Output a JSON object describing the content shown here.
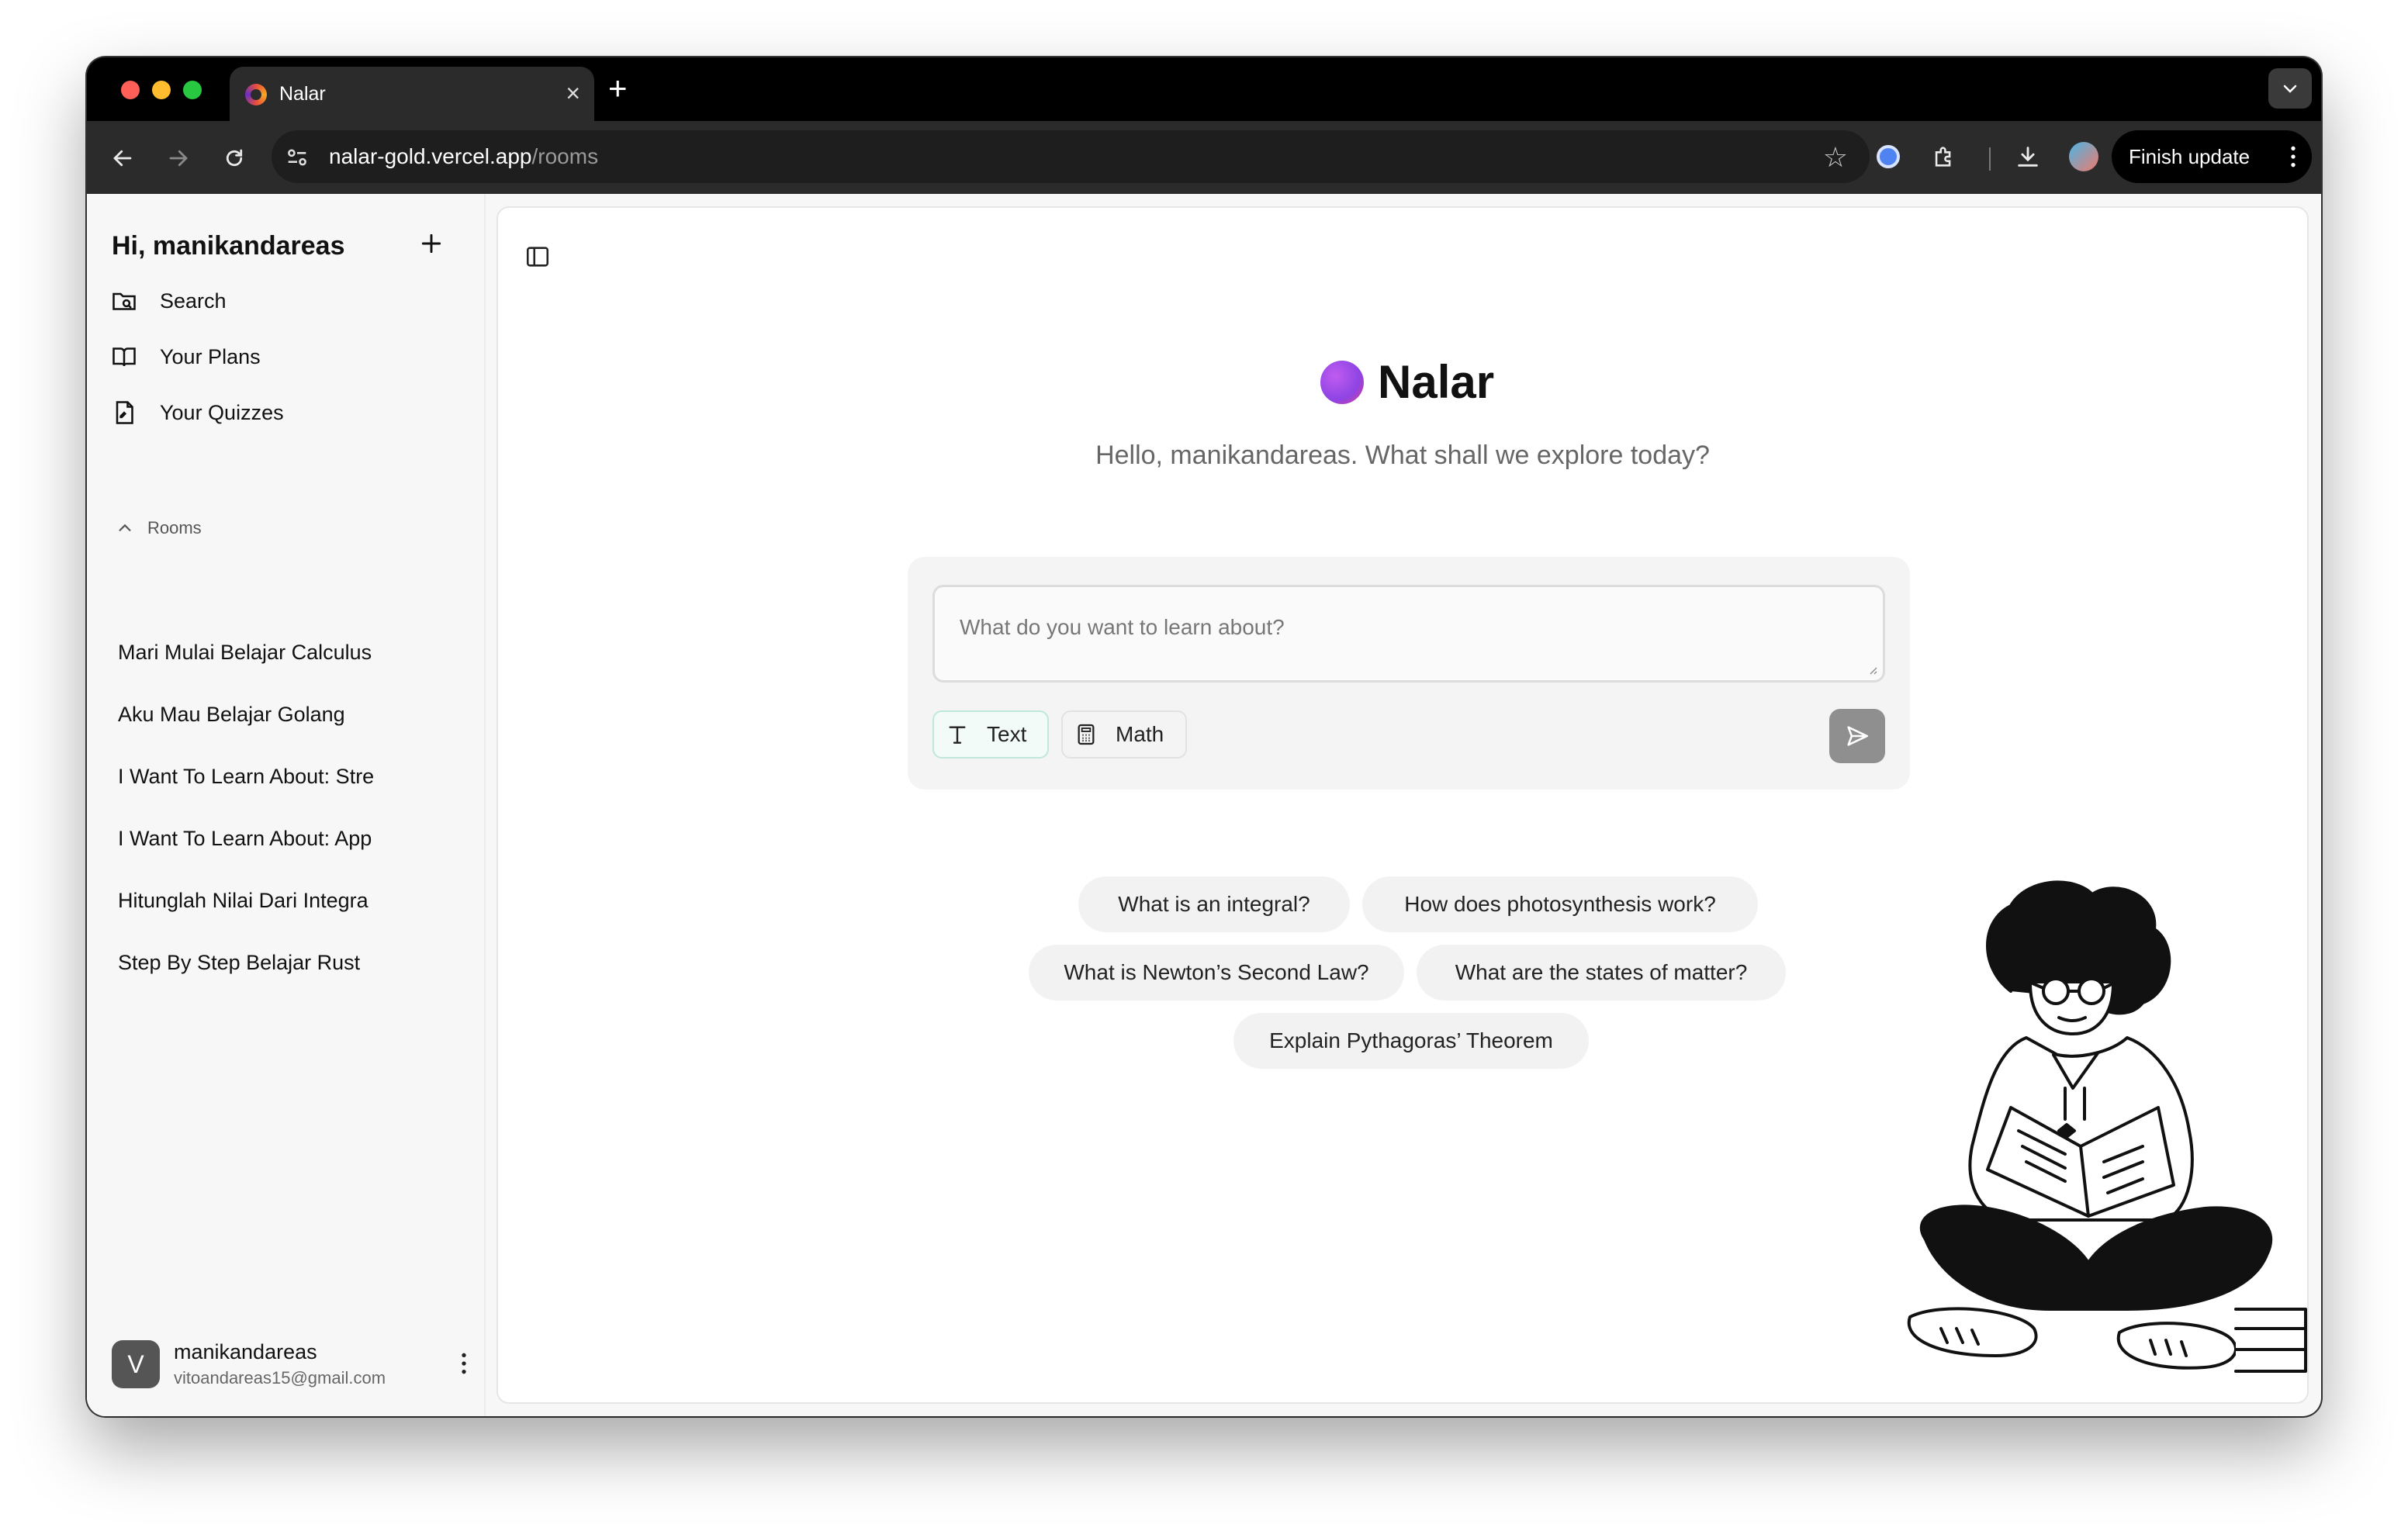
{
  "browser": {
    "tab_title": "Nalar",
    "url_host": "nalar-gold.vercel.app",
    "url_path": "/rooms",
    "finish_update_label": "Finish update"
  },
  "sidebar": {
    "greeting": "Hi, manikandareas",
    "links": [
      {
        "label": "Search",
        "icon": "search-folder-icon"
      },
      {
        "label": "Your Plans",
        "icon": "book-open-icon"
      },
      {
        "label": "Your Quizzes",
        "icon": "file-quiz-icon"
      }
    ],
    "rooms_label": "Rooms",
    "rooms": [
      "Mari Mulai Belajar Calculus",
      "Aku Mau Belajar Golang",
      "I Want To Learn About: Stre",
      "I Want To Learn About: App",
      "Hitunglah Nilai Dari Integra",
      "Step By Step Belajar Rust"
    ],
    "user": {
      "avatar_letter": "V",
      "name": "manikandareas",
      "email": "vitoandareas15@gmail.com"
    }
  },
  "main": {
    "brand_name": "Nalar",
    "subtitle": "Hello, manikandareas. What shall we explore today?",
    "input_placeholder": "What do you want to learn about?",
    "modes": [
      {
        "label": "Text",
        "icon": "text-t-icon",
        "selected": true
      },
      {
        "label": "Math",
        "icon": "calculator-icon",
        "selected": false
      }
    ],
    "suggestions": [
      "What is an integral?",
      "How does photosynthesis work?",
      "What is Newton’s Second Law?",
      "What are the states of matter?",
      "Explain Pythagoras’ Theorem"
    ]
  },
  "colors": {
    "brand_gradient_start": "#c05cf0",
    "brand_gradient_end": "#e33a8e",
    "send_button": "#8f8f8f",
    "text_mode_border": "#bfe7dc"
  }
}
